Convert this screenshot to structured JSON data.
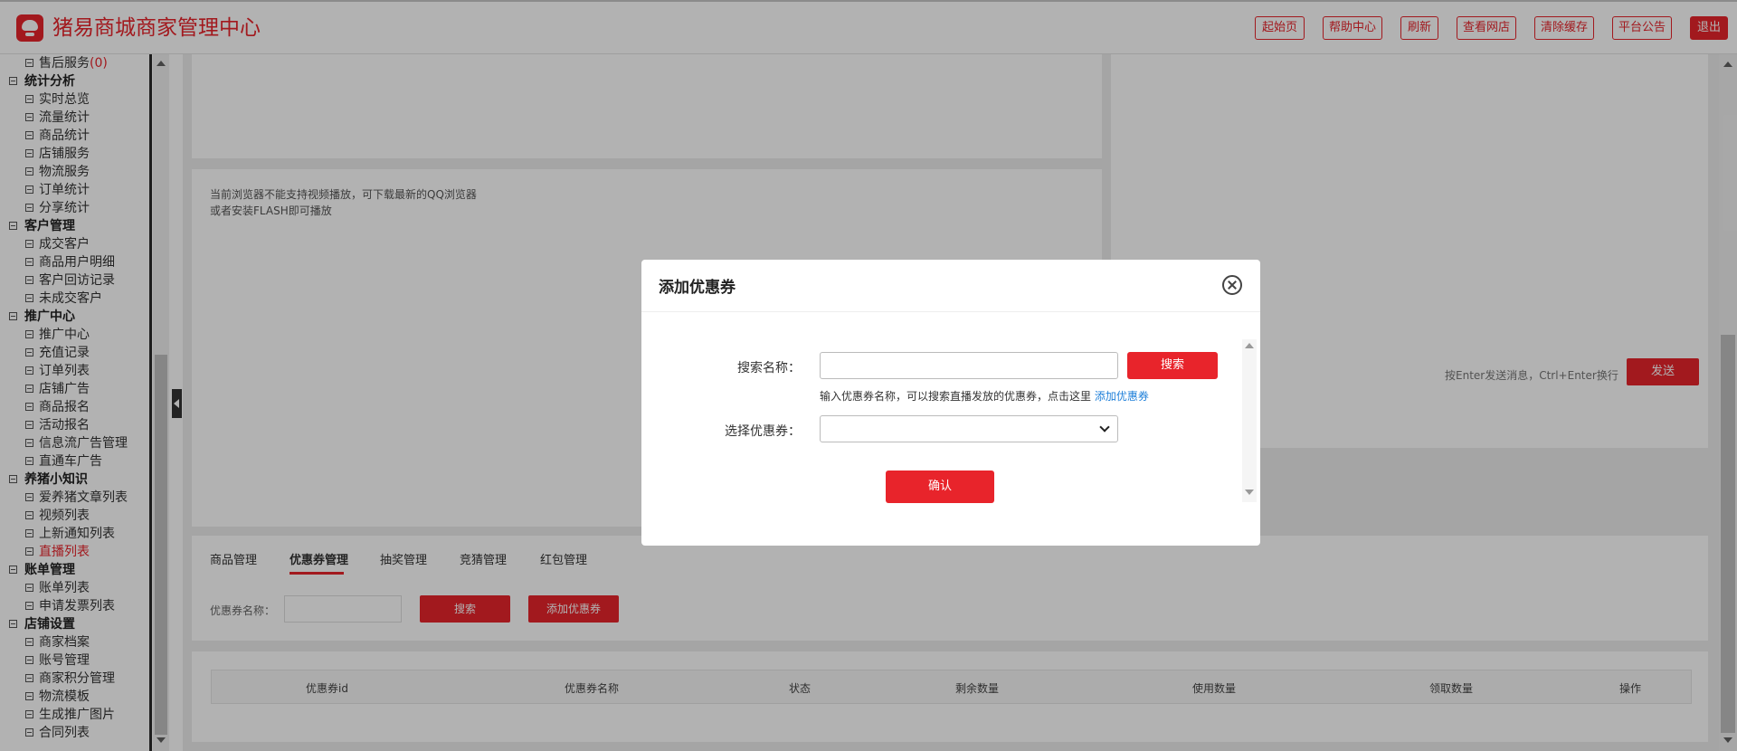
{
  "header": {
    "brand": "猪易商城商家管理中心",
    "buttons": [
      "起始页",
      "帮助中心",
      "刷新",
      "查看网店",
      "清除缓存",
      "平台公告",
      "退出"
    ]
  },
  "sidebar": {
    "first_item": {
      "label": "售后服务",
      "count": "(0)"
    },
    "groups": [
      {
        "label": "统计分析",
        "items": [
          "实时总览",
          "流量统计",
          "商品统计",
          "店铺服务",
          "物流服务",
          "订单统计",
          "分享统计"
        ]
      },
      {
        "label": "客户管理",
        "items": [
          "成交客户",
          "商品用户明细",
          "客户回访记录",
          "未成交客户"
        ]
      },
      {
        "label": "推广中心",
        "items": [
          "推广中心",
          "充值记录",
          "订单列表",
          "店铺广告",
          "商品报名",
          "活动报名",
          "信息流广告管理",
          "直通车广告"
        ]
      },
      {
        "label": "养猪小知识",
        "items": [
          "爱养猪文章列表",
          "视频列表",
          "上新通知列表",
          "直播列表"
        ]
      },
      {
        "label": "账单管理",
        "items": [
          "账单列表",
          "申请发票列表"
        ]
      },
      {
        "label": "店铺设置",
        "items": [
          "商家档案",
          "账号管理",
          "商家积分管理",
          "物流模板",
          "生成推广图片",
          "合同列表"
        ]
      }
    ],
    "active_item": "直播列表"
  },
  "video": {
    "message": "当前浏览器不能支持视频播放，可下载最新的QQ浏览器或者安装FLASH即可播放"
  },
  "chat": {
    "hint": "按Enter发送消息，Ctrl+Enter换行",
    "send_label": "发送"
  },
  "tabs": {
    "items": [
      "商品管理",
      "优惠券管理",
      "抽奖管理",
      "竞猜管理",
      "红包管理"
    ],
    "active": "优惠券管理"
  },
  "filter": {
    "label": "优惠券名称：",
    "search_label": "搜索",
    "add_label": "添加优惠券"
  },
  "table": {
    "columns": [
      "优惠券id",
      "优惠券名称",
      "状态",
      "剩余数量",
      "使用数量",
      "领取数量",
      "操作"
    ]
  },
  "modal": {
    "title": "添加优惠券",
    "search_label": "搜索名称：",
    "search_button": "搜索",
    "hint_text": "输入优惠券名称，可以搜索直播发放的优惠券，点击这里",
    "hint_link": "添加优惠券",
    "select_label": "选择优惠券：",
    "confirm_label": "确认"
  },
  "colors": {
    "accent": "#e8242b",
    "link": "#1e7fd9"
  }
}
